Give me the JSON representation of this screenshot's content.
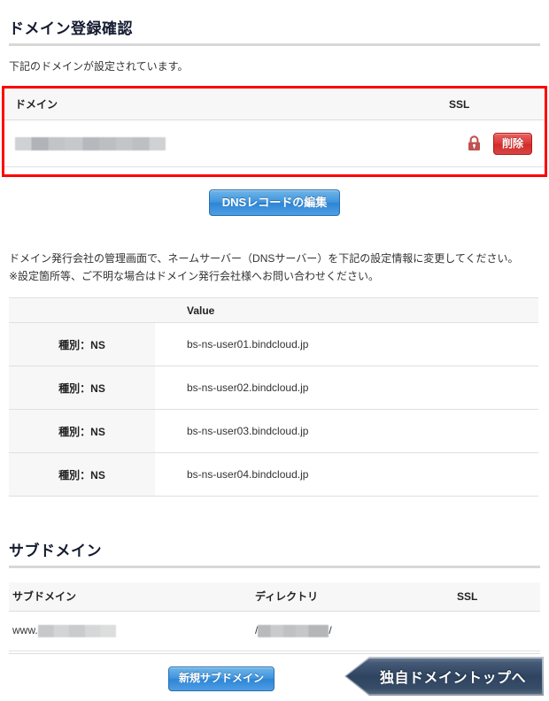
{
  "page": {
    "title": "ドメイン登録確認",
    "lead": "下記のドメインが設定されています。"
  },
  "domain_table": {
    "headers": {
      "domain": "ドメイン",
      "ssl": "SSL"
    },
    "row": {
      "domain_value": "",
      "ssl_icon": "lock-icon",
      "delete_label": "削除"
    }
  },
  "dns_button": {
    "label": "DNSレコードの編集"
  },
  "notice": {
    "line1": "ドメイン発行会社の管理画面で、ネームサーバー（DNSサーバー）を下記の設定情報に変更してください。",
    "line2": "※設定箇所等、ご不明な場合はドメイン発行会社様へお問い合わせください。"
  },
  "ns_table": {
    "headers": {
      "blank": "",
      "value": "Value"
    },
    "rows": [
      {
        "type": "種別：NS",
        "value": "bs-ns-user01.bindcloud.jp"
      },
      {
        "type": "種別：NS",
        "value": "bs-ns-user02.bindcloud.jp"
      },
      {
        "type": "種別：NS",
        "value": "bs-ns-user03.bindcloud.jp"
      },
      {
        "type": "種別：NS",
        "value": "bs-ns-user04.bindcloud.jp"
      }
    ]
  },
  "subdomain_section": {
    "title": "サブドメイン",
    "headers": {
      "subdomain": "サブドメイン",
      "directory": "ディレクトリ",
      "ssl": "SSL"
    },
    "rows": [
      {
        "subdomain_prefix": "www.",
        "subdomain_value": "",
        "directory_open": "/",
        "directory_value": "",
        "directory_close": "/",
        "ssl": ""
      }
    ],
    "new_subdomain_label": "新規サブドメイン"
  },
  "footer": {
    "top_button_label": "独自ドメイントップへ"
  },
  "colors": {
    "highlight_border": "#fe0000",
    "delete_button": "#d93a38",
    "blue_button": "#3f93dd",
    "arrow_button": "#2e4460",
    "lock_icon": "#c0504d",
    "header_bg": "#f7f7f7",
    "title_text": "#141b30"
  }
}
